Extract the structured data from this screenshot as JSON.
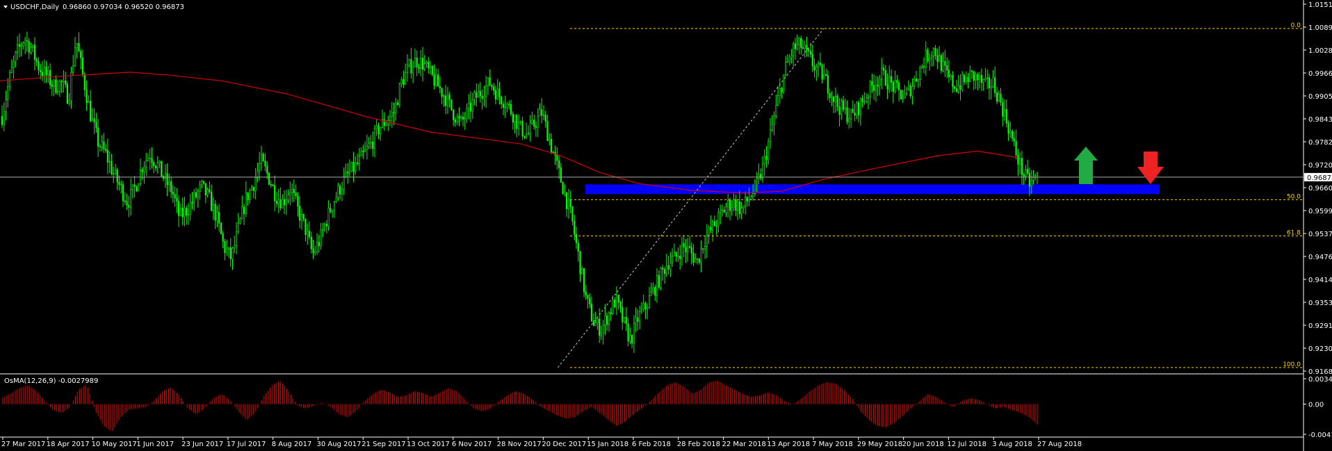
{
  "header": {
    "symbol_label": "USDCHF,Daily",
    "ohlc_label": "0.96860 0.97034 0.96520 0.96873"
  },
  "indicator": {
    "label": "OsMA(12,26,9) -0.0027989",
    "yticks": [
      "0.003483",
      "0.00",
      "-0.004140"
    ]
  },
  "colors": {
    "background": "#000000",
    "grid": "#ffffff",
    "candle": "#00ff00",
    "ma": "#d40000",
    "zone": "#0000ff",
    "fib": "#ffd700",
    "histogram": "#cc0000",
    "arrow_up": "#22aa44",
    "arrow_down": "#ee2222"
  },
  "icons": {
    "menu": "triangle-down-icon",
    "up": "up-arrow-icon",
    "down": "down-arrow-icon"
  },
  "chart_data": {
    "type": "candlestick",
    "symbol": "USDCHF",
    "timeframe": "Daily",
    "ylim": [
      0.91685,
      1.015
    ],
    "price_axis": [
      "1.01510",
      "1.00895",
      "1.00280",
      "0.99665",
      "0.99050",
      "0.98435",
      "0.97820",
      "0.97205",
      "0.96600",
      "0.95990",
      "0.95375",
      "0.94760",
      "0.94145",
      "0.93530",
      "0.92915",
      "0.92300",
      "0.91685"
    ],
    "current_price": "0.96873",
    "x_labels": [
      "27 Mar 2017",
      "18 Apr 2017",
      "10 May 2017",
      "1 Jun 2017",
      "23 Jun 2017",
      "17 Jul 2017",
      "8 Aug 2017",
      "30 Aug 2017",
      "21 Sep 2017",
      "13 Oct 2017",
      "6 Nov 2017",
      "28 Nov 2017",
      "20 Dec 2017",
      "15 Jan 2018",
      "6 Feb 2018",
      "28 Feb 2018",
      "22 Mar 2018",
      "13 Apr 2018",
      "7 May 2018",
      "29 May 2018",
      "20 Jun 2018",
      "12 Jul 2018",
      "3 Aug 2018",
      "27 Aug 2018"
    ],
    "price_path": [
      0.985,
      0.995,
      1.002,
      1.006,
      1.003,
      0.998,
      0.996,
      0.993,
      0.994,
      0.99,
      1.006,
      0.995,
      0.985,
      0.978,
      0.975,
      0.97,
      0.966,
      0.962,
      0.966,
      0.972,
      0.975,
      0.972,
      0.968,
      0.965,
      0.958,
      0.96,
      0.963,
      0.966,
      0.963,
      0.958,
      0.95,
      0.947,
      0.955,
      0.963,
      0.967,
      0.973,
      0.969,
      0.964,
      0.962,
      0.966,
      0.96,
      0.955,
      0.948,
      0.952,
      0.958,
      0.963,
      0.967,
      0.97,
      0.972,
      0.975,
      0.978,
      0.982,
      0.984,
      0.986,
      0.994,
      0.998,
      1.0,
      0.999,
      0.996,
      0.993,
      0.99,
      0.986,
      0.983,
      0.986,
      0.99,
      0.992,
      0.994,
      0.991,
      0.989,
      0.986,
      0.982,
      0.98,
      0.983,
      0.986,
      0.979,
      0.972,
      0.965,
      0.958,
      0.947,
      0.936,
      0.93,
      0.928,
      0.932,
      0.936,
      0.93,
      0.925,
      0.931,
      0.934,
      0.938,
      0.942,
      0.946,
      0.947,
      0.95,
      0.949,
      0.946,
      0.952,
      0.955,
      0.958,
      0.961,
      0.962,
      0.96,
      0.963,
      0.966,
      0.972,
      0.981,
      0.99,
      0.998,
      1.003,
      1.004,
      1.001,
      0.998,
      0.996,
      0.992,
      0.988,
      0.986,
      0.985,
      0.988,
      0.991,
      0.994,
      0.996,
      0.994,
      0.992,
      0.99,
      0.993,
      0.997,
      1.001,
      1.003,
      0.999,
      0.995,
      0.993,
      0.994,
      0.996,
      0.995,
      0.993,
      0.994,
      0.989,
      0.983,
      0.976,
      0.97,
      0.967,
      0.969
    ],
    "moving_average": [
      [
        0.988,
        0.9945
      ],
      [
        0.05,
        0.9958
      ],
      [
        0.1,
        0.9968
      ],
      [
        0.13,
        0.996
      ],
      [
        0.17,
        0.9945
      ],
      [
        0.22,
        0.991
      ],
      [
        0.28,
        0.985
      ],
      [
        0.33,
        0.9808
      ],
      [
        0.37,
        0.979
      ],
      [
        0.4,
        0.9776
      ],
      [
        0.43,
        0.9745
      ],
      [
        0.46,
        0.97
      ],
      [
        0.49,
        0.967
      ],
      [
        0.53,
        0.9652
      ],
      [
        0.57,
        0.9645
      ],
      [
        0.6,
        0.965
      ],
      [
        0.63,
        0.968
      ],
      [
        0.67,
        0.971
      ],
      [
        0.72,
        0.9745
      ],
      [
        0.75,
        0.9757
      ],
      [
        0.78,
        0.974
      ]
    ],
    "support_zone": [
      0.9642,
      0.9668
    ],
    "fibonacci": [
      {
        "level": "0.0",
        "price": 1.0085
      },
      {
        "level": "50.0",
        "price": 0.9627
      },
      {
        "level": "61.8",
        "price": 0.953
      },
      {
        "level": "100.0",
        "price": 0.9178
      }
    ],
    "trendline": [
      [
        0.428,
        0.9178
      ],
      [
        0.632,
        1.0085
      ]
    ],
    "osma_ylim": [
      -0.00414,
      0.003483
    ],
    "osma": [
      0.0009,
      0.0015,
      0.0022,
      0.0026,
      0.0018,
      0.0004,
      -0.0008,
      -0.0012,
      -0.0004,
      0.002,
      0.0027,
      -0.001,
      -0.003,
      -0.0038,
      -0.0018,
      -0.0008,
      -0.0006,
      -0.0004,
      0.0005,
      0.0018,
      0.0023,
      0.0012,
      -0.0006,
      -0.0014,
      -0.0006,
      0.0008,
      0.0014,
      0.0006,
      -0.001,
      -0.0022,
      -0.0012,
      0.001,
      0.0026,
      0.0032,
      0.0018,
      -0.0002,
      -0.0006,
      -0.0002,
      0.0002,
      -0.0004,
      -0.0014,
      -0.0018,
      -0.001,
      0.0004,
      0.0014,
      0.002,
      0.0016,
      0.001,
      0.0012,
      0.0018,
      0.0015,
      0.001,
      0.0016,
      0.0022,
      0.0018,
      0.0006,
      -0.0006,
      -0.001,
      -0.0006,
      0.0004,
      0.0012,
      0.0018,
      0.0014,
      0.0006,
      -0.0004,
      -0.001,
      -0.0016,
      -0.002,
      -0.0018,
      -0.001,
      -0.0004,
      -0.0012,
      -0.0022,
      -0.003,
      -0.0024,
      -0.0014,
      -0.0006,
      0.0004,
      0.0016,
      0.0026,
      0.003,
      0.0024,
      0.0014,
      0.002,
      0.003,
      0.0032,
      0.0026,
      0.002,
      0.0014,
      0.001,
      0.0012,
      0.0016,
      0.0012,
      0.0004,
      0.0,
      0.0008,
      0.0018,
      0.0026,
      0.003,
      0.0028,
      0.002,
      0.0008,
      -0.001,
      -0.0022,
      -0.003,
      -0.0032,
      -0.0026,
      -0.0016,
      -0.0006,
      0.0004,
      0.0014,
      0.001,
      0.0002,
      -0.0004,
      0.0004,
      0.0008,
      0.0006,
      0.0,
      -0.0006,
      -0.0004,
      -0.0008,
      -0.0012,
      -0.0018,
      -0.0028
    ]
  }
}
